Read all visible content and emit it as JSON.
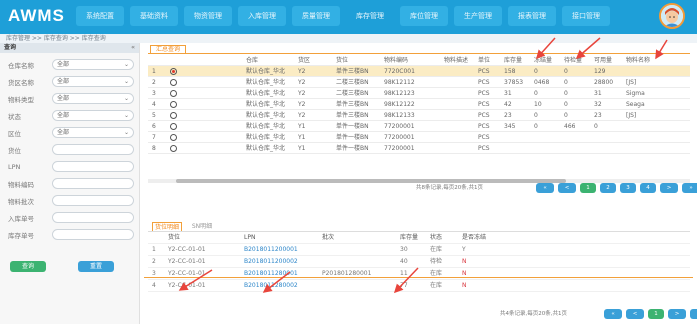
{
  "app": {
    "logo": "AWMS"
  },
  "nav": [
    "系统配置",
    "基础资料",
    "物资管理",
    "入库管理",
    "质量管理",
    "库存管理",
    "库位管理",
    "生产管理",
    "报表管理",
    "接口管理"
  ],
  "breadcrumb": "库存管理 >> 库存查询 >> 库存查询",
  "sidebar": {
    "title": "查询",
    "collapse": "«",
    "filters": [
      {
        "label": "仓库名称",
        "value": "全部",
        "type": "select"
      },
      {
        "label": "货区名称",
        "value": "全部",
        "type": "select"
      },
      {
        "label": "物料类型",
        "value": "全部",
        "type": "select"
      },
      {
        "label": "状态",
        "value": "全部",
        "type": "select"
      },
      {
        "label": "区位",
        "value": "全部",
        "type": "select"
      },
      {
        "label": "货位",
        "value": "",
        "type": "input"
      },
      {
        "label": "LPN",
        "value": "",
        "type": "input"
      },
      {
        "label": "物料编码",
        "value": "",
        "type": "input"
      },
      {
        "label": "物料批次",
        "value": "",
        "type": "input"
      },
      {
        "label": "入库单号",
        "value": "",
        "type": "input"
      },
      {
        "label": "库存单号",
        "value": "",
        "type": "input"
      }
    ],
    "query_btn": "查询",
    "reset_btn": "重置"
  },
  "top_grid": {
    "tab": "汇总查询",
    "columns": [
      "",
      "",
      "仓库",
      "货区",
      "货位",
      "物料编码",
      "物料描述",
      "单位",
      "库存量",
      "冻结量",
      "待检量",
      "可用量",
      "物料名称"
    ],
    "rows": [
      {
        "idx": "1",
        "sel": true,
        "wh": "默认仓库_华北",
        "area": "Y2",
        "pos": "单件三楼BN",
        "code": "7720C001",
        "desc": "",
        "unit": "PCS",
        "qty": "158",
        "frozen": "0",
        "check": "0",
        "avail": "129",
        "name": ""
      },
      {
        "idx": "2",
        "sel": false,
        "wh": "默认仓库_华北",
        "area": "Y2",
        "pos": "二楼三楼BN",
        "code": "98K12112",
        "desc": "",
        "unit": "PCS",
        "qty": "37853",
        "frozen": "0468",
        "check": "0",
        "avail": "28800",
        "name": "[JS]"
      },
      {
        "idx": "3",
        "sel": false,
        "wh": "默认仓库_华北",
        "area": "Y2",
        "pos": "二楼三楼BN",
        "code": "98K12123",
        "desc": "",
        "unit": "PCS",
        "qty": "31",
        "frozen": "0",
        "check": "0",
        "avail": "31",
        "name": "Sigma"
      },
      {
        "idx": "4",
        "sel": false,
        "wh": "默认仓库_华北",
        "area": "Y2",
        "pos": "单件三楼BN",
        "code": "98K12122",
        "desc": "",
        "unit": "PCS",
        "qty": "42",
        "frozen": "10",
        "check": "0",
        "avail": "32",
        "name": "Seaga"
      },
      {
        "idx": "5",
        "sel": false,
        "wh": "默认仓库_华北",
        "area": "Y2",
        "pos": "单件三楼BN",
        "code": "98K12133",
        "desc": "",
        "unit": "PCS",
        "qty": "23",
        "frozen": "0",
        "check": "0",
        "avail": "23",
        "name": "[JS]"
      },
      {
        "idx": "6",
        "sel": false,
        "wh": "默认仓库_华北",
        "area": "Y1",
        "pos": "单件一楼BN",
        "code": "77200001",
        "desc": "",
        "unit": "PCS",
        "qty": "345",
        "frozen": "0",
        "check": "466",
        "avail": "0",
        "name": ""
      },
      {
        "idx": "7",
        "sel": false,
        "wh": "默认仓库_华北",
        "area": "Y1",
        "pos": "单件一楼BN",
        "code": "77200001",
        "desc": "",
        "unit": "PCS",
        "qty": "",
        "frozen": "",
        "check": "",
        "avail": "",
        "name": ""
      },
      {
        "idx": "8",
        "sel": false,
        "wh": "默认仓库_华北",
        "area": "Y1",
        "pos": "单件一楼BN",
        "code": "77200001",
        "desc": "",
        "unit": "PCS",
        "qty": "",
        "frozen": "",
        "check": "",
        "avail": "",
        "name": ""
      }
    ],
    "pager_info": "共8条记录,每页20条,共1页",
    "pager": [
      "«",
      "<",
      "1",
      "2",
      "3",
      "4",
      ">",
      "»"
    ]
  },
  "detail": {
    "tab_on": "货位明细",
    "tab_off": "SN明细",
    "columns": [
      "货位",
      "LPN",
      "批次",
      "库存量",
      "状态",
      "是否冻结"
    ],
    "rows": [
      {
        "pos": "Y2-CC-01-01",
        "lpn": "B2018011200001",
        "batch": "",
        "qty": "30",
        "status": "在库",
        "frozen": "Y"
      },
      {
        "pos": "Y2-CC-01-01",
        "lpn": "B2018011200002",
        "batch": "",
        "qty": "40",
        "status": "待检",
        "frozen": "N"
      },
      {
        "pos": "Y2-CC-01-01",
        "lpn": "B2018011280001",
        "batch": "P201801280001",
        "qty": "11",
        "status": "在库",
        "frozen": "N"
      },
      {
        "pos": "Y2-CC-01-01",
        "lpn": "B2018011280002",
        "batch": "",
        "qty": "77",
        "status": "在库",
        "frozen": "N"
      }
    ],
    "pager_info": "共4条记录,每页20条,共1页",
    "pager": [
      "«",
      "<",
      "1",
      ">",
      "»"
    ]
  },
  "colors": {
    "topbar": "#1e9fd8",
    "accent": "#f28a1d",
    "green": "#3cb371",
    "selected_row": "#fbecc4",
    "arrow": "#e8453c"
  }
}
